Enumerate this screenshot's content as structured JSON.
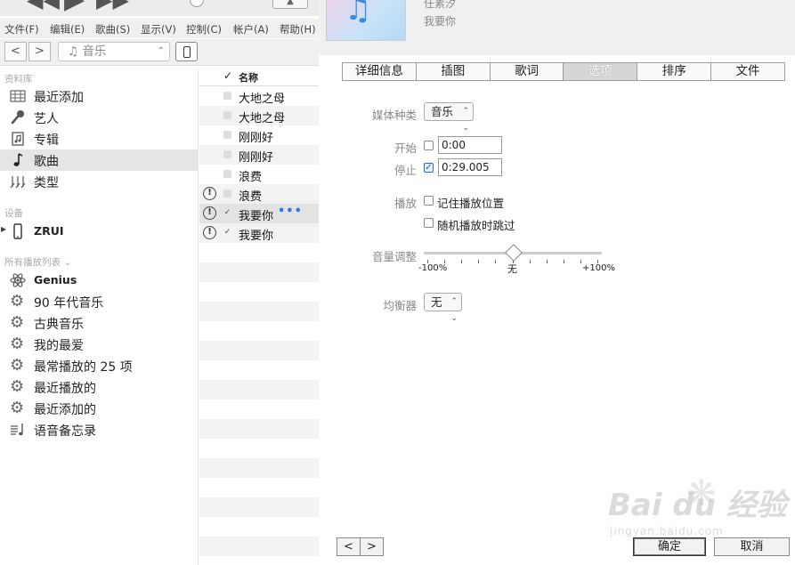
{
  "menubar": {
    "items": [
      "文件(F)",
      "编辑(E)",
      "歌曲(S)",
      "显示(V)",
      "控制(C)",
      "帐户(A)",
      "帮助(H)"
    ]
  },
  "navbar": {
    "back_icon": "chevron-left",
    "forward_icon": "chevron-right",
    "media_select": "♫ 音乐",
    "device_icon": "iphone-icon"
  },
  "sidebar": {
    "library_header": "资料库",
    "library": [
      {
        "label": "最近添加",
        "icon": "grid-icon"
      },
      {
        "label": "艺人",
        "icon": "microphone-icon"
      },
      {
        "label": "专辑",
        "icon": "album-icon"
      },
      {
        "label": "歌曲",
        "icon": "music-note-icon",
        "selected": true
      },
      {
        "label": "类型",
        "icon": "genre-icon"
      }
    ],
    "devices_header": "设备",
    "device": {
      "label": "ZRUI",
      "icon": "iphone-icon"
    },
    "playlists_header": "所有播放列表 ⌄",
    "playlists": [
      {
        "label": "Genius",
        "icon": "atom-icon"
      },
      {
        "label": "90 年代音乐",
        "icon": "gear-icon"
      },
      {
        "label": "古典音乐",
        "icon": "gear-icon"
      },
      {
        "label": "我的最爱",
        "icon": "gear-icon"
      },
      {
        "label": "最常播放的 25 项",
        "icon": "gear-icon"
      },
      {
        "label": "最近播放的",
        "icon": "gear-icon"
      },
      {
        "label": "最近添加的",
        "icon": "gear-icon"
      },
      {
        "label": "语音备忘录",
        "icon": "voice-memo-icon"
      }
    ]
  },
  "songlist": {
    "header_check": "✓",
    "header_name": "名称",
    "rows": [
      {
        "name": "大地之母",
        "checked": false,
        "warning": false
      },
      {
        "name": "大地之母",
        "checked": false,
        "warning": false
      },
      {
        "name": "刚刚好",
        "checked": false,
        "warning": false
      },
      {
        "name": "刚刚好",
        "checked": false,
        "warning": false
      },
      {
        "name": "浪费",
        "checked": false,
        "warning": false
      },
      {
        "name": "浪费",
        "checked": false,
        "warning": true
      },
      {
        "name": "我要你",
        "checked": true,
        "warning": true,
        "selected": true,
        "more": "•••"
      },
      {
        "name": "我要你",
        "checked": true,
        "warning": true
      }
    ]
  },
  "dialog": {
    "artist": "任素汐",
    "title": "我要你",
    "tabs": [
      "详细信息",
      "插图",
      "歌词",
      "选项",
      "排序",
      "文件"
    ],
    "active_tab": "选项",
    "media_kind_label": "媒体种类",
    "media_kind_value": "音乐",
    "start_label": "开始",
    "start_checked": false,
    "start_value": "0:00",
    "stop_label": "停止",
    "stop_checked": true,
    "stop_value": "0:29.005",
    "playback_label": "播放",
    "remember_position": "记住播放位置",
    "skip_shuffle": "随机播放时跳过",
    "volume_label": "音量调整",
    "volume_min": "-100%",
    "volume_mid": "无",
    "volume_max": "+100%",
    "volume_level": 0.5,
    "eq_label": "均衡器",
    "eq_value": "无",
    "ok_button": "确定",
    "cancel_button": "取消"
  },
  "watermark": {
    "text": "Bai du 经验",
    "url": "jingyan.baidu.com"
  }
}
